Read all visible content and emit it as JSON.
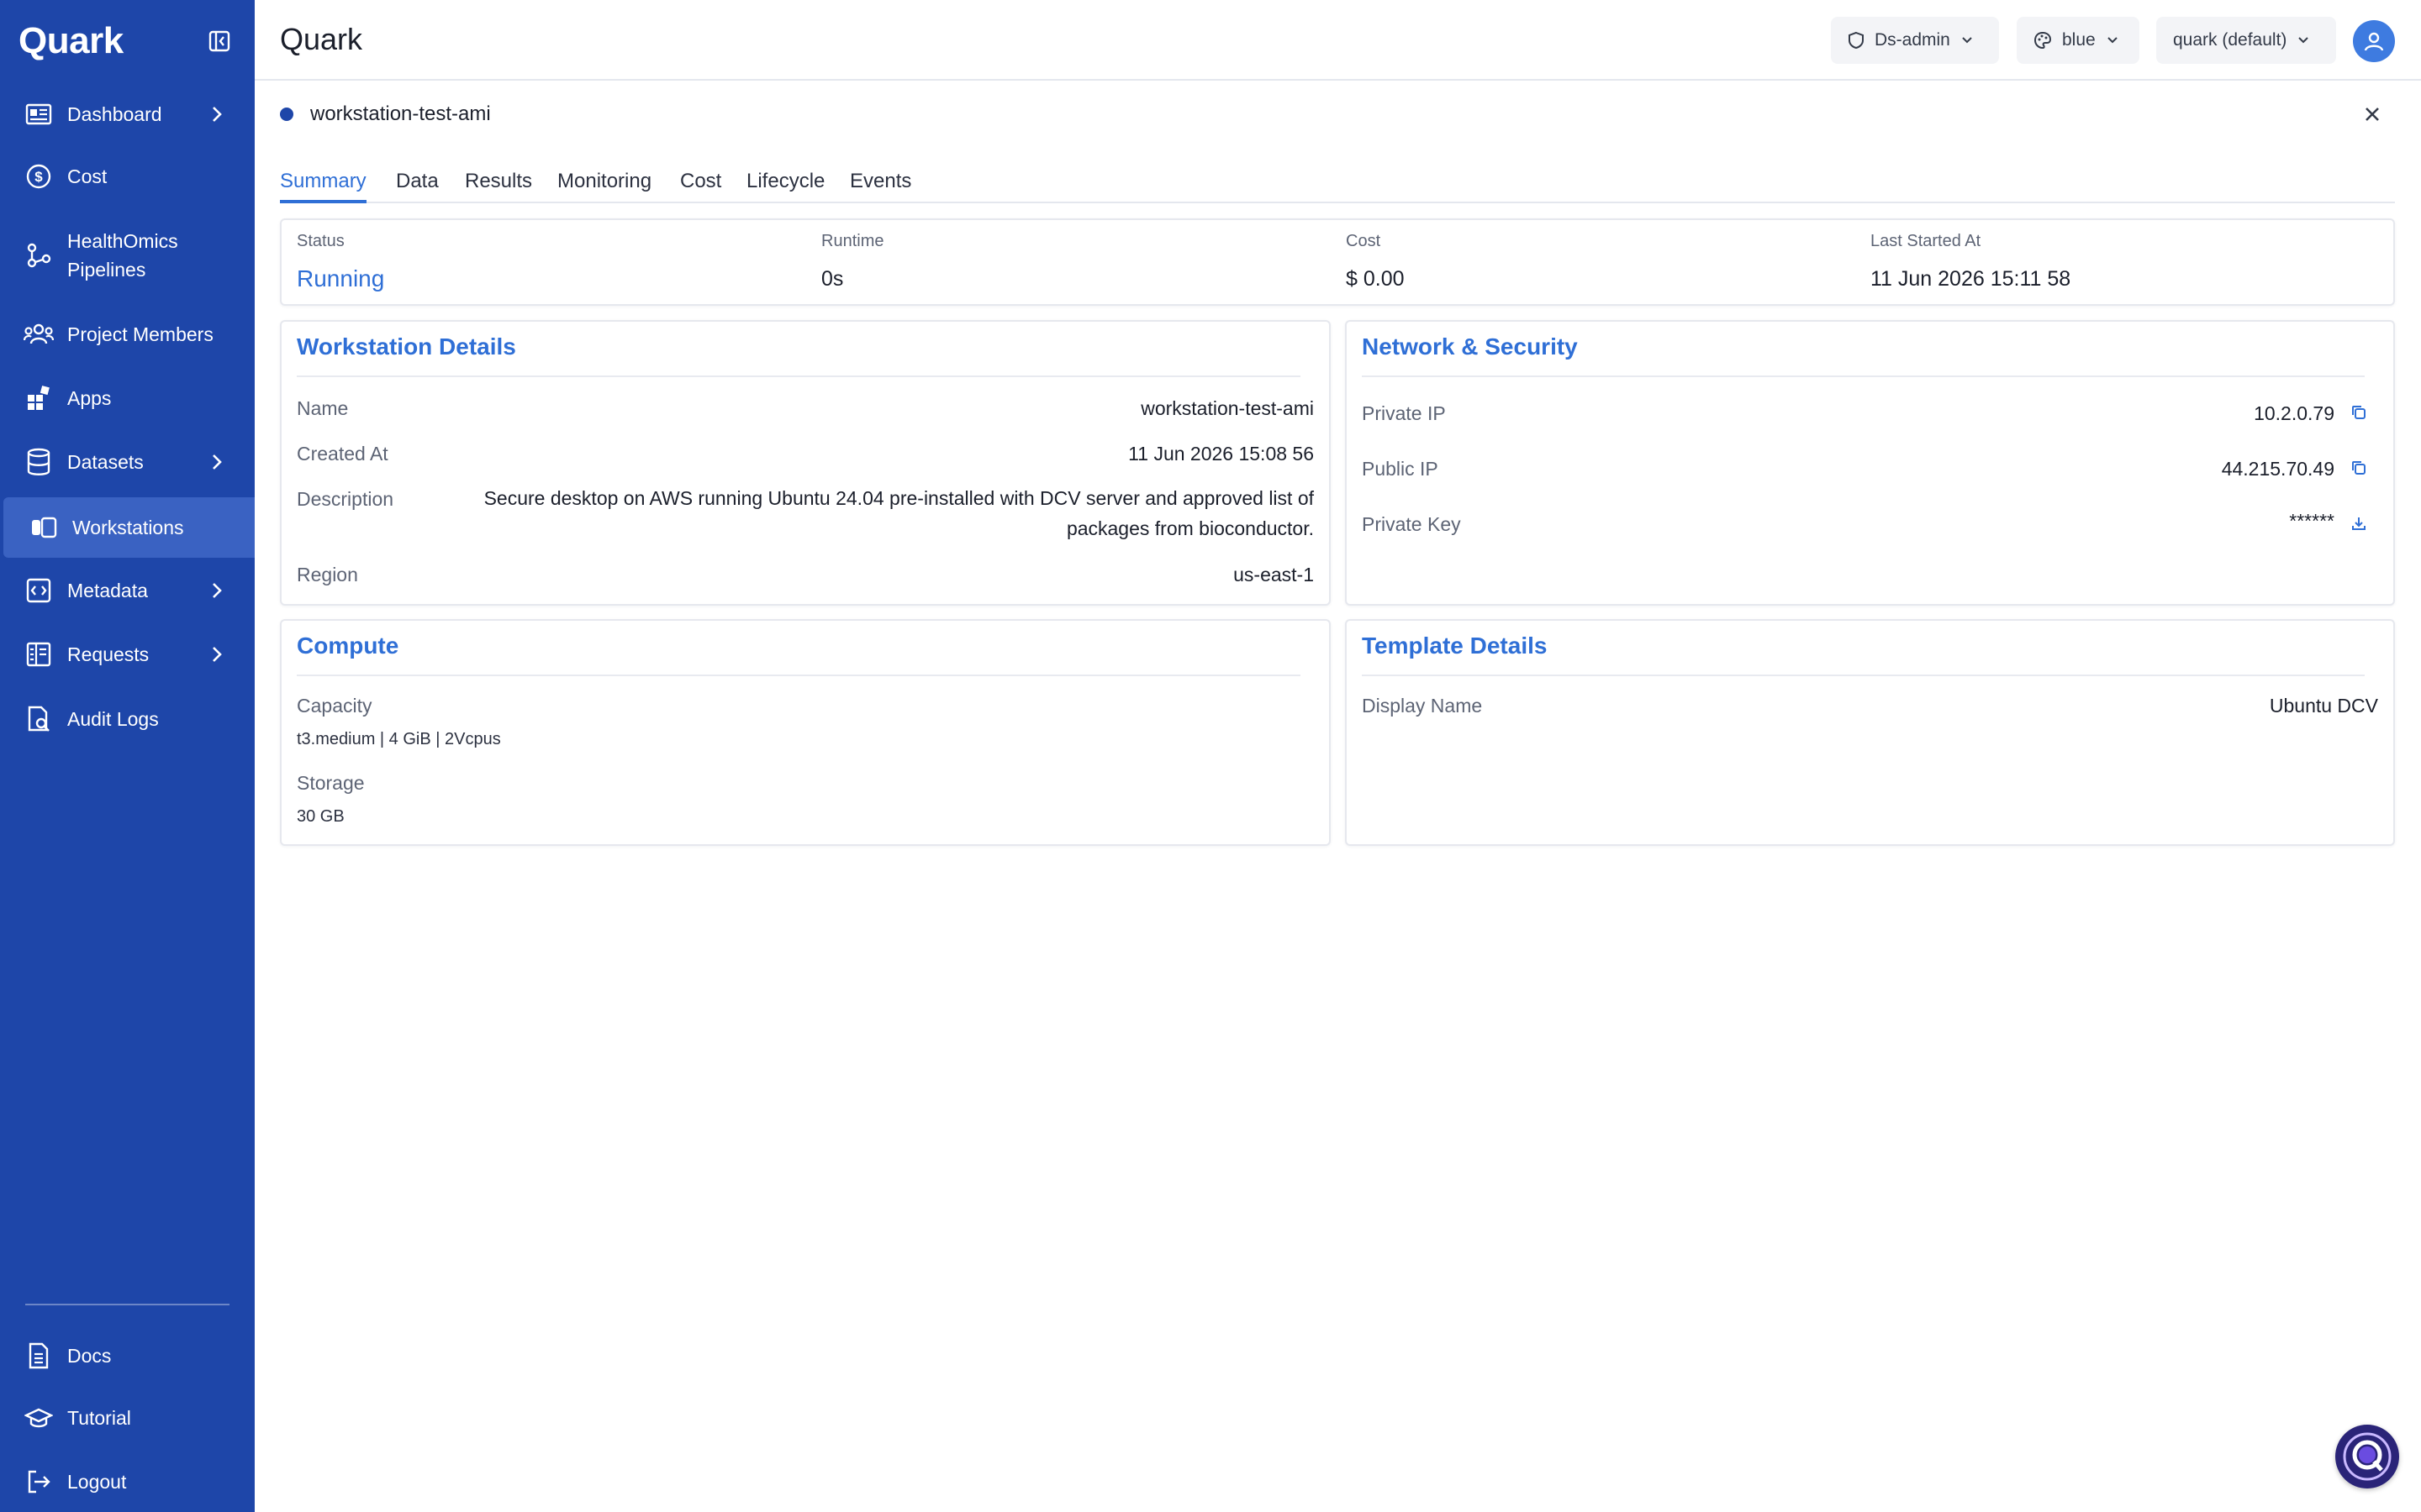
{
  "sidebar": {
    "brand": "Quark",
    "items": [
      {
        "label": "Dashboard",
        "icon": "dashboard-icon",
        "chevron": true
      },
      {
        "label": "Cost",
        "icon": "dollar-circle-icon",
        "chevron": false
      },
      {
        "label": "HealthOmics\nPipelines",
        "label_line1": "HealthOmics",
        "label_line2": "Pipelines",
        "icon": "pipeline-icon",
        "chevron": false
      },
      {
        "label": "Project Members",
        "icon": "users-icon",
        "chevron": false
      },
      {
        "label": "Apps",
        "icon": "apps-icon",
        "chevron": false
      },
      {
        "label": "Datasets",
        "icon": "database-icon",
        "chevron": true
      },
      {
        "label": "Workstations",
        "icon": "workstation-icon",
        "chevron": false,
        "active": true
      },
      {
        "label": "Metadata",
        "icon": "code-icon",
        "chevron": true
      },
      {
        "label": "Requests",
        "icon": "requests-icon",
        "chevron": true
      },
      {
        "label": "Audit Logs",
        "icon": "audit-log-icon",
        "chevron": false
      }
    ],
    "footer": [
      {
        "label": "Docs",
        "icon": "document-icon"
      },
      {
        "label": "Tutorial",
        "icon": "graduation-cap-icon"
      },
      {
        "label": "Logout",
        "icon": "logout-icon"
      }
    ]
  },
  "header": {
    "title": "Quark",
    "role": "Ds-admin",
    "theme": "blue",
    "project": "quark (default)"
  },
  "detail": {
    "name": "workstation-test-ami",
    "tabs": [
      "Summary",
      "Data",
      "Results",
      "Monitoring",
      "Cost",
      "Lifecycle",
      "Events"
    ],
    "active_tab": "Summary"
  },
  "summary": {
    "status_label": "Status",
    "status_value": "Running",
    "runtime_label": "Runtime",
    "runtime_value": "0s",
    "cost_label": "Cost",
    "cost_value": "$ 0.00",
    "last_started_label": "Last Started At",
    "last_started_value": "11 Jun 2026 15:11 58"
  },
  "workstation_details": {
    "title": "Workstation Details",
    "name_label": "Name",
    "name_value": "workstation-test-ami",
    "created_label": "Created At",
    "created_value": "11 Jun 2026 15:08 56",
    "description_label": "Description",
    "description_value": "Secure desktop on AWS running Ubuntu 24.04 pre-installed with DCV server and approved list of packages from bioconductor.",
    "region_label": "Region",
    "region_value": "us-east-1"
  },
  "network_security": {
    "title": "Network & Security",
    "private_ip_label": "Private IP",
    "private_ip_value": "10.2.0.79",
    "public_ip_label": "Public IP",
    "public_ip_value": "44.215.70.49",
    "private_key_label": "Private Key",
    "private_key_value": "******"
  },
  "compute": {
    "title": "Compute",
    "capacity_label": "Capacity",
    "capacity_value": "t3.medium | 4 GiB | 2Vcpus",
    "storage_label": "Storage",
    "storage_value": "30 GB"
  },
  "template_details": {
    "title": "Template Details",
    "display_name_label": "Display Name",
    "display_name_value": "Ubuntu DCV"
  },
  "colors": {
    "sidebar_bg": "#1e46a9",
    "sidebar_active": "#3a62c2",
    "accent": "#2f6fd6"
  }
}
